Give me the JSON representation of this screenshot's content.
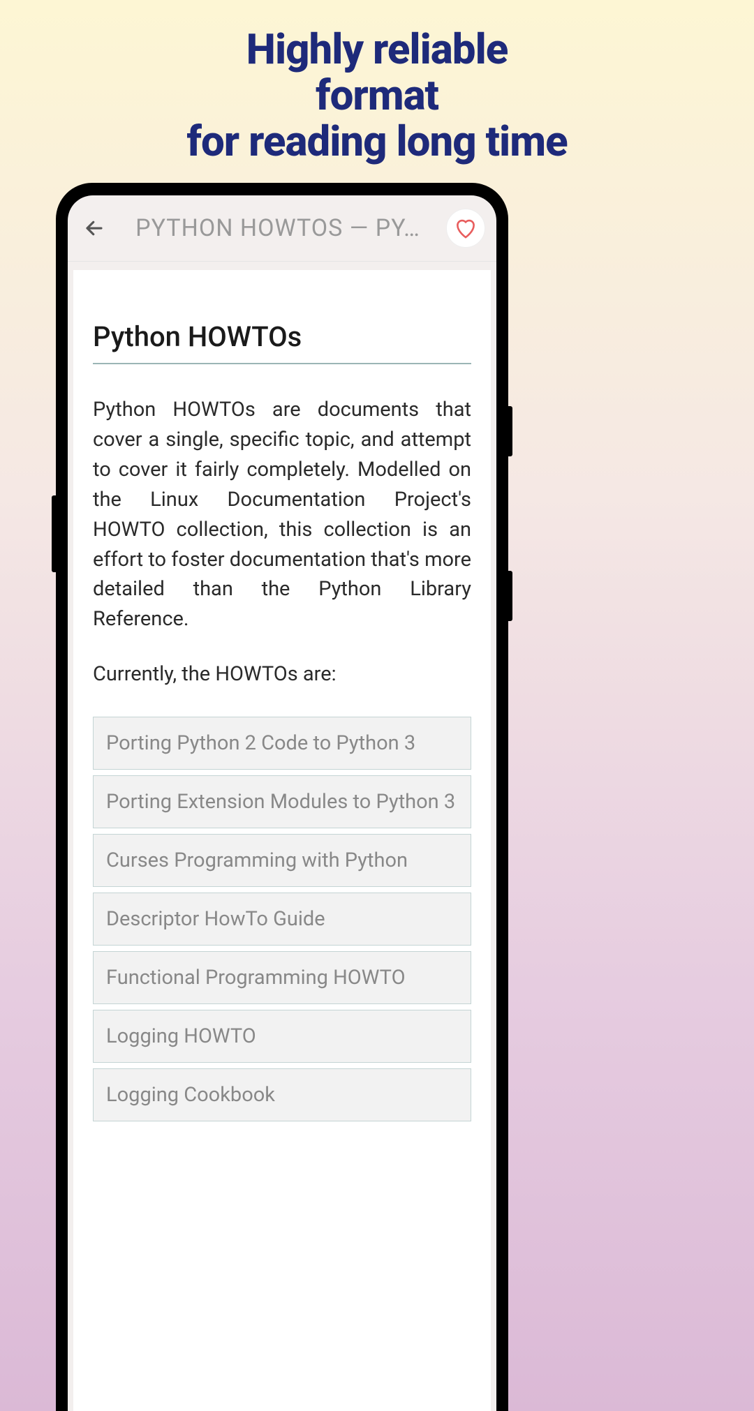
{
  "marketing": {
    "line1": "Highly reliable",
    "line2": "format",
    "line3": "for reading long time"
  },
  "header": {
    "title": "PYTHON HOWTOS — PY…"
  },
  "content": {
    "title": "Python HOWTOs",
    "intro": "Python HOWTOs are documents that cover a single, specific topic, and attempt to cover it fairly completely. Modelled on the Linux Documentation Project's HOWTO collection, this collection is an effort to foster documentation that's more detailed than the Python Library Reference.",
    "subheading": "Currently, the HOWTOs are:",
    "items": [
      "Porting Python 2 Code to Python 3",
      "Porting Extension Modules to Python 3",
      "Curses Programming with Python",
      "Descriptor HowTo Guide",
      "Functional Programming HOWTO",
      "Logging HOWTO",
      "Logging Cookbook"
    ]
  }
}
